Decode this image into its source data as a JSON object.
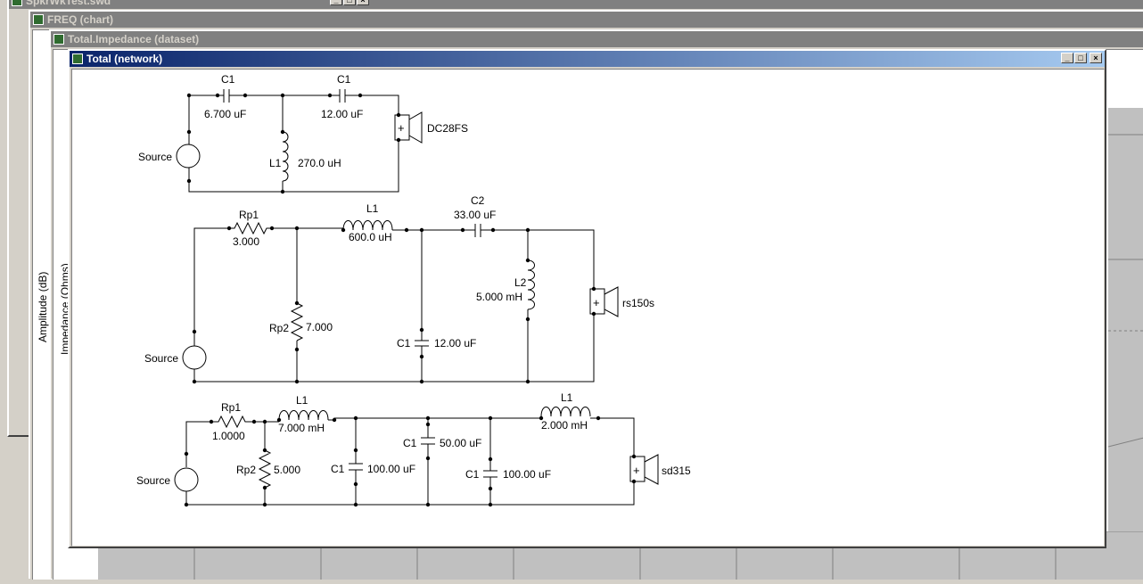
{
  "windows": {
    "top_file": {
      "title": "SpkrWkTest.swd"
    },
    "freq_chart": {
      "title": "FREQ (chart)",
      "y_axis_label": "Amplitude (dB)"
    },
    "impedance_dataset": {
      "title": "Total.Impedance (dataset)",
      "y_axis_label": "Impedance (Ohms)"
    },
    "network": {
      "title": "Total (network)"
    }
  },
  "colors": {
    "active_title": "#0a246a",
    "inactive_title": "#808080",
    "face": "#d4d0c8"
  },
  "circuit1": {
    "c1a_name": "C1",
    "c1a_value": "6.700 uF",
    "c1b_name": "C1",
    "c1b_value": "12.00 uF",
    "l1_name": "L1",
    "l1_value": "270.0 uH",
    "source": "Source",
    "driver": "DC28FS",
    "plus": "+"
  },
  "circuit2": {
    "rp1_name": "Rp1",
    "rp1_value": "3.000",
    "l1_name": "L1",
    "l1_value": "600.0 uH",
    "c2_name": "C2",
    "c2_value": "33.00 uF",
    "l2_name": "L2",
    "l2_value": "5.000 mH",
    "rp2_name": "Rp2",
    "rp2_value": "7.000",
    "c1_name": "C1",
    "c1_value": "12.00 uF",
    "source": "Source",
    "driver": "rs150s",
    "plus": "+"
  },
  "circuit3": {
    "rp1_name": "Rp1",
    "rp1_value": "1.0000",
    "l1_name": "L1",
    "l1_value": "7.000 mH",
    "l1b_name": "L1",
    "l1b_value": "2.000 mH",
    "rp2_name": "Rp2",
    "rp2_value": "5.000",
    "c1a_name": "C1",
    "c1a_value": "100.00 uF",
    "c1b_name": "C1",
    "c1b_value": "50.00 uF",
    "c1c_name": "C1",
    "c1c_value": "100.00 uF",
    "source": "Source",
    "driver": "sd315",
    "plus": "+"
  },
  "controls": {
    "minimize": "_",
    "maximize": "□",
    "close": "×"
  }
}
